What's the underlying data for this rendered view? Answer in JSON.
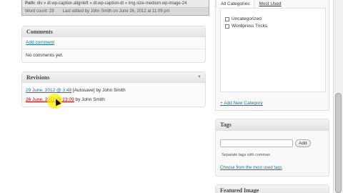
{
  "editor_status": {
    "path_label": "Path:",
    "path": "div » dl.wp-caption.alignleft » dt.wp-caption-dt » img.size-medium.wp-image-24",
    "word_count": "Word count: 29",
    "last_edited": "Last edited by John Smith on June 26, 2012 at 11:09 pm"
  },
  "comments": {
    "title": "Comments",
    "add_link": "Add comment",
    "empty_text": "No comments yet."
  },
  "revisions": {
    "title": "Revisions",
    "toggle": "▼",
    "items": [
      {
        "link": "29 June, 2012 @ 3:48",
        "suffix": " [Autosave] by John Smith"
      },
      {
        "link": "26 June, 2012 @ 23:09",
        "suffix": " by John Smith"
      }
    ]
  },
  "categories": {
    "tab_all": "All Categories",
    "tab_used": "Most Used",
    "items": [
      "Uncategorized",
      "Wordpress Tricks"
    ],
    "add_new": "+ Add New Category"
  },
  "tags": {
    "title": "Tags",
    "add_button": "Add",
    "hint": "Separate tags with commas",
    "choose_link": "Choose from the most used tags"
  },
  "featured_image": {
    "title": "Featured Image"
  }
}
